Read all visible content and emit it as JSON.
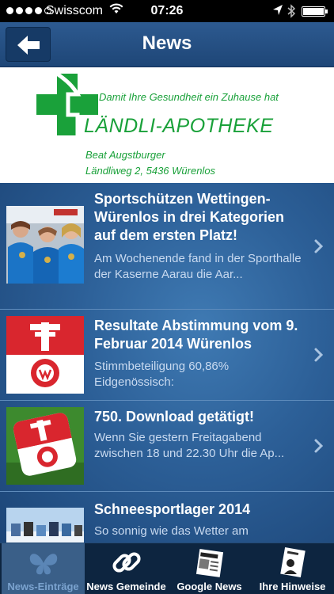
{
  "status_bar": {
    "carrier": "Swisscom",
    "time": "07:26",
    "signal_strength": 4,
    "battery_level": 1.0
  },
  "nav": {
    "title": "News",
    "back_icon": "back-arrow-icon"
  },
  "ad_banner": {
    "tagline": "Damit Ihre Gesundheit ein Zuhause hat",
    "name": "LÄNDLI-APOTHEKE",
    "owner": "Beat Augstburger",
    "address": "Ländliweg 2, 5436 Würenlos",
    "brand_color": "#1aa13a",
    "logo_icon": "pharmacy-cross-icon"
  },
  "news": [
    {
      "title": "Sportschützen Wettingen-Würenlos in drei Kategorien auf dem ersten Platz!",
      "excerpt": "Am Wochenende fand in der Sporthalle der Kaserne Aarau die Aar...",
      "thumbnail": "team-photo"
    },
    {
      "title": "Resultate Abstimmung vom 9. Februar 2014 Würenlos",
      "excerpt": "Stimmbeteiligung 60,86% Eidgenössisch:",
      "thumbnail": "wuerenlos-coat-of-arms"
    },
    {
      "title": "750. Download getätigt!",
      "excerpt": "Wenn Sie gestern Freitagabend zwischen 18 und 22.30 Uhr die Ap...",
      "thumbnail": "app-icon"
    },
    {
      "title": "Schneesportlager 2014",
      "excerpt": "So sonnig wie das Wetter am",
      "thumbnail": "ski-camp-photo"
    }
  ],
  "tabs": [
    {
      "label": "News-Einträge",
      "icon": "butterfly-icon",
      "active": true
    },
    {
      "label": "News Gemeinde",
      "icon": "chain-link-icon",
      "active": false
    },
    {
      "label": "Google News",
      "icon": "newspaper-icon",
      "active": false
    },
    {
      "label": "Ihre Hinweise",
      "icon": "contact-card-icon",
      "active": false
    }
  ],
  "colors": {
    "nav_bar": "#2d5a90",
    "list_background": "#2c5f97",
    "tab_bar": "#0d2540",
    "tab_active": "#3a5f88",
    "flag_red": "#d9262e"
  }
}
